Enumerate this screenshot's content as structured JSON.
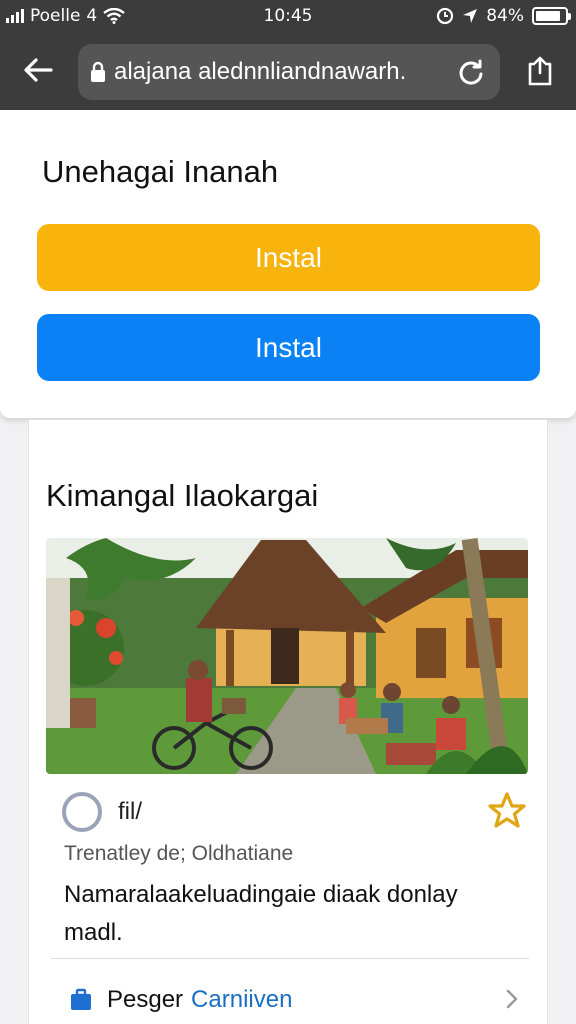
{
  "status_bar": {
    "carrier": "Poelle",
    "carrier_extra": "4",
    "time": "10:45",
    "battery_percent_label": "84%",
    "battery_level": 0.84
  },
  "toolbar": {
    "url": "alajana alednnliandnawarh."
  },
  "install_sheet": {
    "title": "Unehagai Inanah",
    "primary_button": "Instal",
    "secondary_button": "Instal",
    "colors": {
      "primary": "#f8b30c",
      "secondary": "#0a82f6"
    }
  },
  "card": {
    "title": "Kimangal Ilaokargai",
    "image_alt": "village scene",
    "meta_label": "fil/",
    "subtitle": "Trenatley de; Oldhatiane",
    "description": "Namaralaakeluadingaie diaak donlay madl.",
    "link": {
      "label": "Pesger",
      "accent": "Carniiven"
    },
    "accent_color": "#1a6fc4"
  }
}
